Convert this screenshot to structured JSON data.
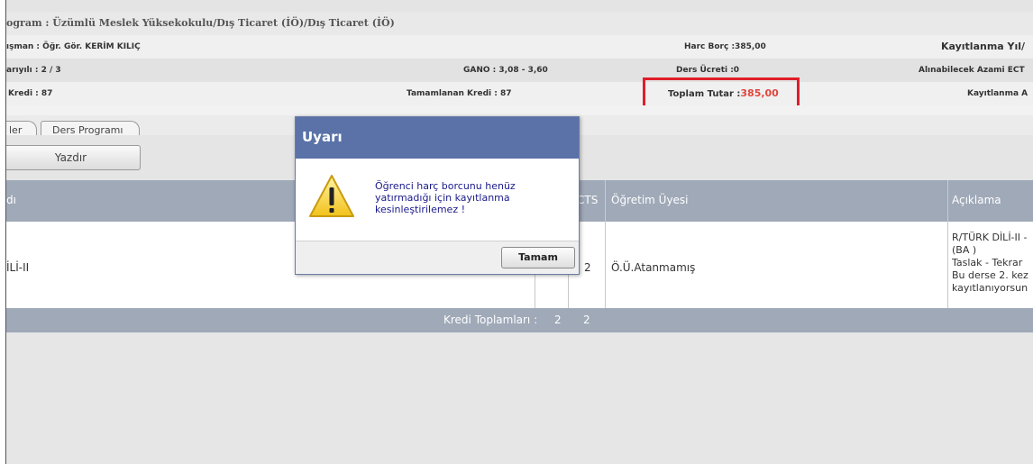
{
  "info": {
    "program": "ogram : Üzümlü Meslek Yüksekokulu/Dış Ticaret (İÖ)/Dış Ticaret (İÖ)",
    "advisor": "ışman : Öğr. Gör. KERİM KILIÇ",
    "fee_debt": "Harc Borç :385,00",
    "enroll_year": "Kayıtlanma Yıl/",
    "semester": "arıyılı : 2 / 3",
    "gano": "GANO : 3,08 - 3,60",
    "course_fee": "Ders Ücreti :0",
    "max_ects": "Alınabilecek Azami ECT",
    "credit": "Kredi : 87",
    "completed_credit": "Tamamlanan Kredi : 87",
    "total_label": "Toplam Tutar :",
    "total_value": "385,00",
    "enroll_trunc": "Kayıtlanma A"
  },
  "tabs": [
    {
      "label": "ler"
    },
    {
      "label": "Ders Programı"
    }
  ],
  "toolbar": {
    "print_label": "Yazdır"
  },
  "table": {
    "headers": {
      "name": "dı",
      "ects": "CTS",
      "instructor": "Öğretim Üyesi",
      "notes": "Açıklama"
    },
    "row": {
      "name": "İLİ-II",
      "ects": "2",
      "instructor": "Ö.Ü.Atanmamış",
      "notes": [
        "R/TÜRK DİLİ-II -",
        "(BA )",
        "Taslak - Tekrar",
        "Bu derse 2. kez",
        "kayıtlanıyorsun"
      ]
    },
    "footer": {
      "label": "Kredi Toplamları :",
      "val1": "2",
      "val2": "2"
    }
  },
  "dialog": {
    "title": "Uyarı",
    "message": "Öğrenci harç borcunu henüz yatırmadığı için kayıtlanma kesinleştirilemez !",
    "ok_label": "Tamam",
    "icon": "warning-icon"
  },
  "colors": {
    "highlight": "#e11d2a",
    "accent": "#5a72a8",
    "header": "#9fa9b8",
    "amount": "#e0463e"
  }
}
